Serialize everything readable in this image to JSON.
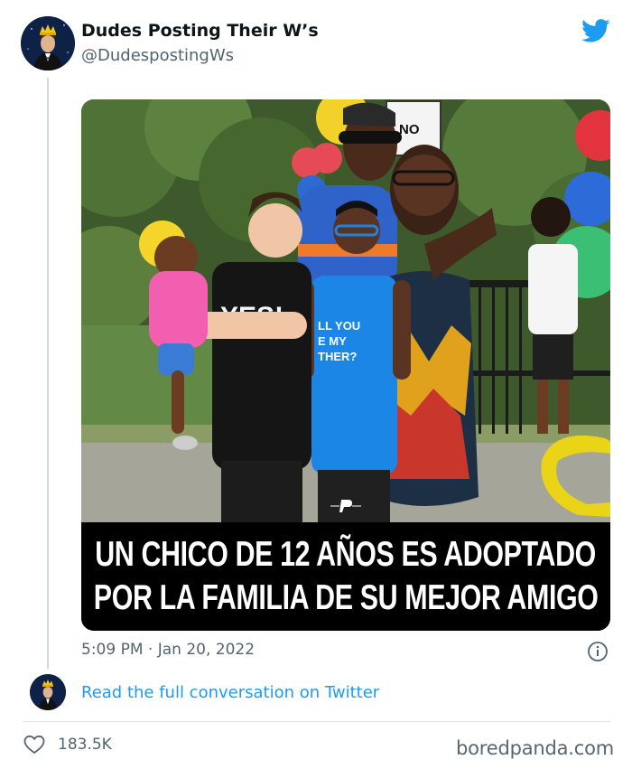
{
  "tweet": {
    "author_name": "Dudes Posting Their W’s",
    "author_handle": "@DudespostingWs",
    "timestamp": "5:09 PM · Jan 20, 2022",
    "likes": "183.5K"
  },
  "media": {
    "caption_line1": "UN CHICO DE 12 AÑOS ES ADOPTADO",
    "caption_line2": "POR LA FAMILIA DE SU MEJOR AMIGO",
    "shirt_text_left": "YES!",
    "shirt_text_right": "...LL YOU\nBE MY\n...THER?",
    "sign_text": "NO"
  },
  "footer": {
    "read_link": "Read the full conversation on Twitter",
    "watermark": "boredpanda.com"
  },
  "colors": {
    "link_blue": "#1d9bf0",
    "muted_gray": "#536471",
    "caption_bg": "#000000",
    "twitter_blue": "#1d9bf0"
  },
  "icons": [
    "twitter-bird-icon",
    "info-icon",
    "heart-icon",
    "avatar-crown"
  ]
}
